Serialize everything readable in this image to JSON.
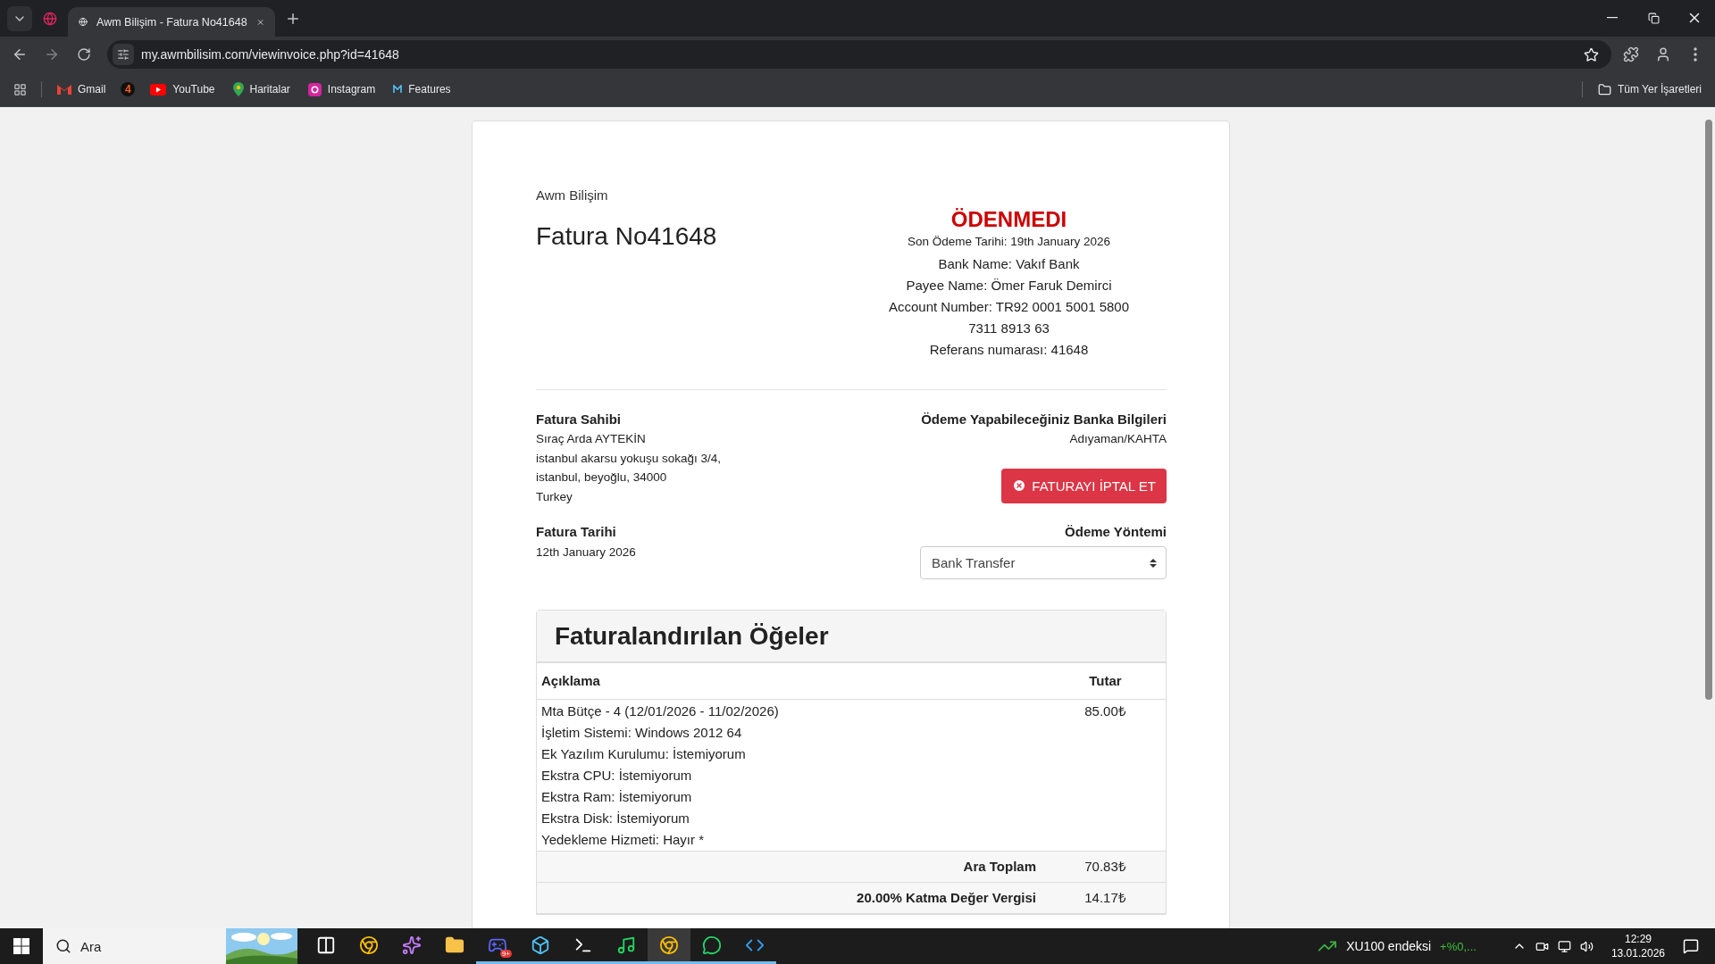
{
  "browser": {
    "tabs": [
      {
        "title": "Awm Bilişim - Fatura No41648",
        "selected": true
      }
    ],
    "url": "my.awmbilisim.com/viewinvoice.php?id=41648",
    "bookmarks": [
      {
        "kind": "gmail",
        "label": "Gmail"
      },
      {
        "kind": "badge",
        "icon_text": "4"
      },
      {
        "kind": "youtube",
        "label": "YouTube"
      },
      {
        "kind": "maps",
        "label": "Haritalar"
      },
      {
        "kind": "instagram",
        "label": "Instagram"
      },
      {
        "kind": "features",
        "label": "Features"
      }
    ],
    "all_bookmarks": "Tüm Yer İşaretleri"
  },
  "invoice": {
    "logo_alt": "Awm Bilişim",
    "title": "Fatura No41648",
    "status": "ÖDENMEDI",
    "due_date": "Son Ödeme Tarihi: 19th January 2026",
    "bank_lines": [
      "Bank Name: Vakıf Bank",
      "Payee Name: Ömer Faruk Demirci",
      "Account Number: TR92 0001 5001 5800 7311 8913 63",
      "Referans numarası: 41648"
    ],
    "billed_to": {
      "heading": "Fatura Sahibi",
      "lines": [
        "Sıraç Arda AYTEKİN",
        "istanbul akarsu yokuşu sokağı 3/4,",
        "istanbul, beyoğlu, 34000",
        "Turkey"
      ]
    },
    "bank_info": {
      "heading": "Ödeme Yapabileceğiniz Banka Bilgileri",
      "line": "Adıyaman/KAHTA"
    },
    "cancel_button": "FATURAYI İPTAL ET",
    "date": {
      "heading": "Fatura Tarihi",
      "value": "12th January 2026"
    },
    "payment_method": {
      "heading": "Ödeme Yöntemi",
      "value": "Bank Transfer"
    },
    "items": {
      "title": "Faturalandırılan Öğeler",
      "columns": [
        "Açıklama",
        "Tutar"
      ],
      "rows": [
        {
          "lines": [
            "Mta Bütçe - 4 (12/01/2026 - 11/02/2026)",
            "İşletim Sistemi: Windows 2012 64",
            "Ek Yazılım Kurulumu: İstemiyorum",
            "Ekstra CPU: İstemiyorum",
            "Ekstra Ram: İstemiyorum",
            "Ekstra Disk: İstemiyorum",
            "Yedekleme Hizmeti: Hayır *"
          ],
          "amount": "85.00₺"
        }
      ],
      "totals": [
        {
          "label": "Ara Toplam",
          "amount": "70.83₺"
        },
        {
          "label": "20.00% Katma Değer Vergisi",
          "amount": "14.17₺"
        }
      ]
    }
  },
  "taskbar": {
    "search_placeholder": "Ara",
    "apps": [
      {
        "kind": "taskview",
        "active": false
      },
      {
        "kind": "chrome",
        "active": false
      },
      {
        "kind": "copilot",
        "active": false
      },
      {
        "kind": "folder",
        "active": false
      },
      {
        "kind": "discord",
        "active": true,
        "badge": "9+"
      },
      {
        "kind": "tool",
        "active": true
      },
      {
        "kind": "terminal",
        "active": true
      },
      {
        "kind": "spotify",
        "active": true
      },
      {
        "kind": "chrome",
        "active": true,
        "selected": true
      },
      {
        "kind": "whatsapp",
        "active": true
      },
      {
        "kind": "vscode",
        "active": true
      }
    ],
    "widget": {
      "label": "XU100 endeksi",
      "change": "+%0,..."
    },
    "time": "12:29",
    "date": "13.01.2026"
  }
}
